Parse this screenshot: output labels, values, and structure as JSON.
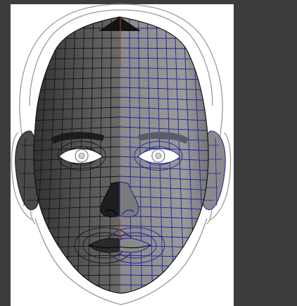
{
  "viewport": {
    "background_color": "#3c3c3c",
    "reference_image_background": "#ffffff",
    "reference_sketch_color": "#9a9a9a",
    "mesh_colors": {
      "shaded_left": "#5a5a5a",
      "shaded_right": "#8c8c8c",
      "edge_left": "#1a1a1a",
      "wireframe_right": "#1f1f9e",
      "symmetry_seam": "#c0392b",
      "eye_white": "#ffffff",
      "iris": "#bdbdbd"
    },
    "view": "front",
    "wireframe_half": "right",
    "shaded_half": "left"
  }
}
